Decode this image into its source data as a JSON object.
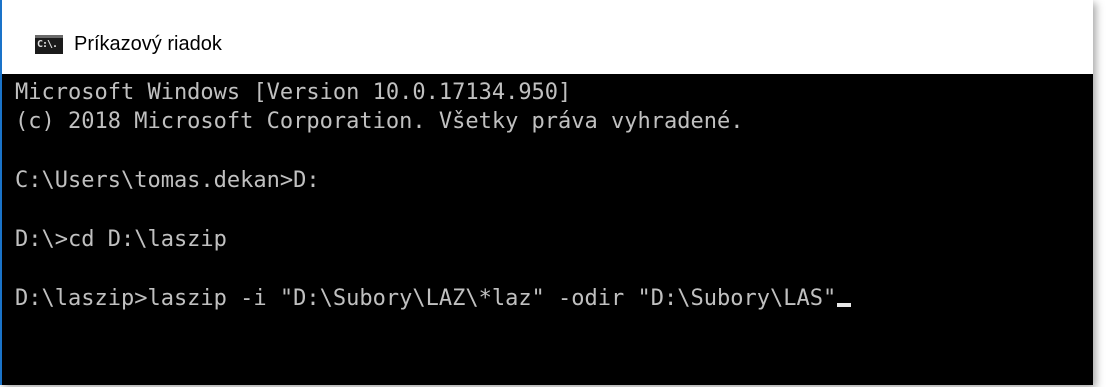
{
  "window": {
    "title": "Príkazový riadok",
    "icon": "cmd-icon",
    "icon_text": "C:\\."
  },
  "console": {
    "lines": [
      "Microsoft Windows [Version 10.0.17134.950]",
      "(c) 2018 Microsoft Corporation. Všetky práva vyhradené.",
      "",
      "C:\\Users\\tomas.dekan>D:",
      "",
      "D:\\>cd D:\\laszip",
      "",
      "D:\\laszip>laszip -i \"D:\\Subory\\LAZ\\*laz\" -odir \"D:\\Subory\\LAS\""
    ]
  },
  "colors": {
    "console_background": "#000000",
    "console_text": "#c0c0c0",
    "titlebar_background": "#ffffff",
    "window_accent": "#1a73c9"
  }
}
